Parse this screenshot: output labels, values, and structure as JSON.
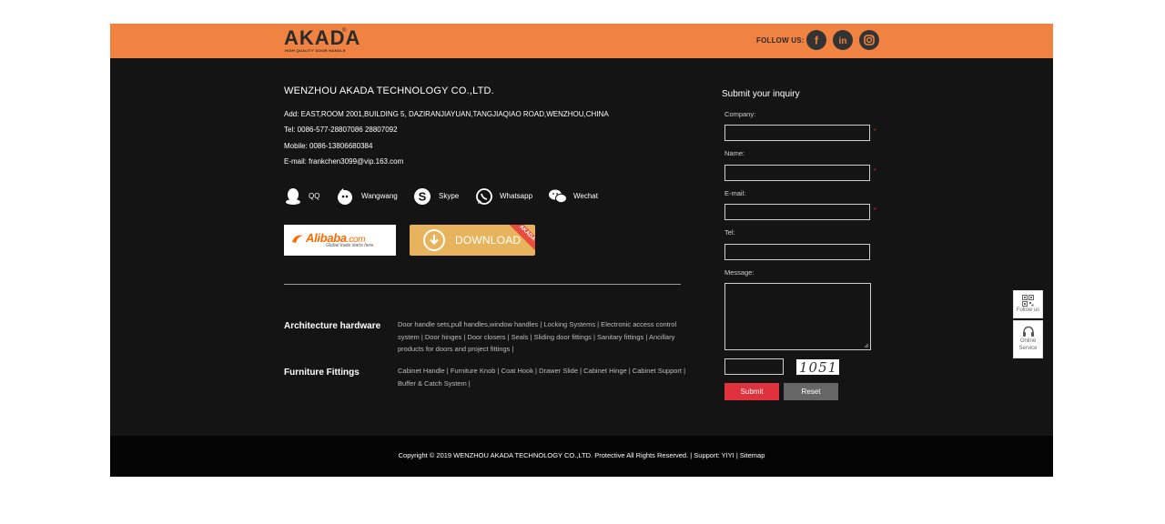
{
  "header": {
    "logo_text": "AKADA",
    "logo_registered": "®",
    "logo_tagline": "HIGH QUALITY DOOR HANDLE",
    "follow_label": "FOLLOW US:",
    "social": [
      {
        "icon": "facebook-icon",
        "glyph": "f"
      },
      {
        "icon": "linkedin-icon",
        "glyph": "in"
      },
      {
        "icon": "instagram-icon",
        "glyph": ""
      }
    ],
    "bar_color": "#f08341"
  },
  "company": {
    "name": "WENZHOU AKADA TECHNOLOGY CO.,LTD.",
    "address": "Add: EAST,ROOM 2001,BUILDING 5, DAZIRANJIAYUAN,TANGJIAQIAO ROAD,WENZHOU,CHINA",
    "tel": "Tel: 0086-577-28807086 28807092",
    "mobile": "Mobile: 0086-13806680384",
    "email": "E-mail: frankchen3099@vip.163.com"
  },
  "contacts": [
    {
      "icon": "qq-icon",
      "label": "QQ"
    },
    {
      "icon": "wangwang-icon",
      "label": "Wangwang"
    },
    {
      "icon": "skype-icon",
      "label": "Skype"
    },
    {
      "icon": "whatsapp-icon",
      "label": "Whatsapp"
    },
    {
      "icon": "wechat-icon",
      "label": "Wechat"
    }
  ],
  "badges": {
    "alibaba_main": "Alibaba",
    "alibaba_com": ".com",
    "alibaba_sub": "Global trade starts here.",
    "download_label": "DOWNLOAD",
    "download_ribbon": "AKADA"
  },
  "categories": [
    {
      "title": "Architecture hardware",
      "links": "Door handle sets,pull handles,window handles | Locking Systems | Electronic access control system | Door hinges | Door closers | Seals | Sliding door fittings | Sanitary fittings | Ancillary products for doors and project fittings |"
    },
    {
      "title": "Furniture Fittings",
      "links": "Cabinet Handle | Furniture Knob | Coat Hook | Drawer Slide | Cabinet Hinge | Cabinet Support | Buffer & Catch System |"
    }
  ],
  "form": {
    "title": "Submit your inquiry",
    "company_label": "Company:",
    "name_label": "Name:",
    "email_label": "E-mail:",
    "tel_label": "Tel:",
    "message_label": "Message:",
    "required_mark": "*",
    "captcha_text": "1051",
    "submit_label": "Submit",
    "reset_label": "Reset",
    "submit_color": "#e0323c"
  },
  "footer": {
    "copyright": "Copyright © 2019 WENZHOU AKADA TECHNOLOGY CO.,LTD. Protective All Rights Reserved. | Support: YIYI | Sitemap"
  },
  "side": {
    "follow_label": "Follow us",
    "online_label_1": "Online",
    "online_label_2": "Service"
  }
}
